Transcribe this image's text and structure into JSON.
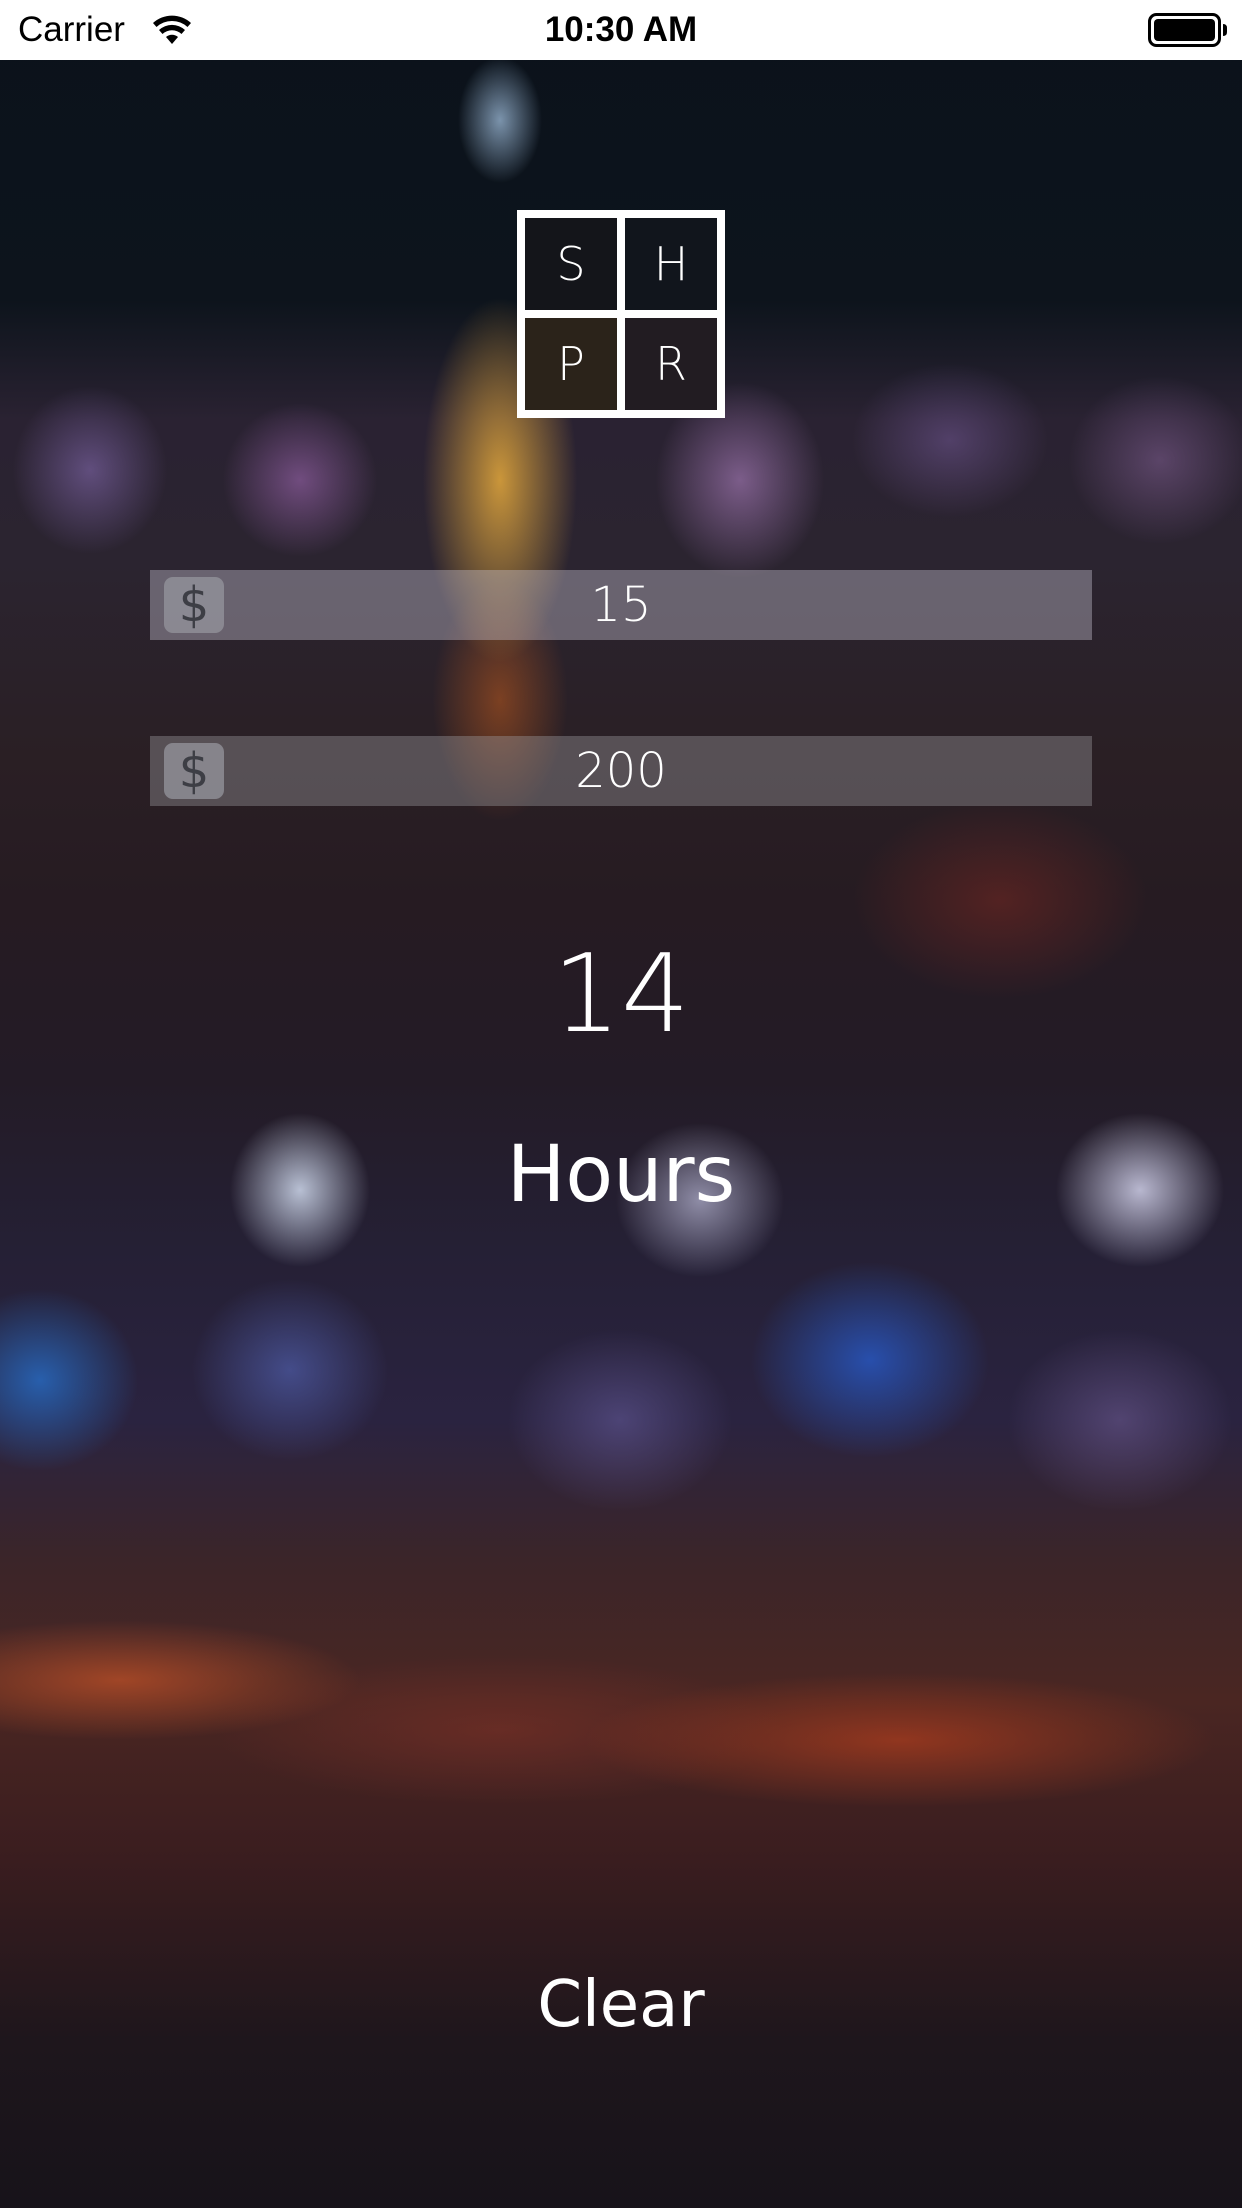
{
  "status_bar": {
    "carrier": "Carrier",
    "time": "10:30 AM",
    "wifi_icon": "wifi-icon",
    "battery_icon": "battery-icon"
  },
  "logo": {
    "letters": [
      "S",
      "H",
      "P",
      "R"
    ]
  },
  "fields": [
    {
      "icon": "dollar-icon",
      "icon_glyph": "$",
      "value": "15"
    },
    {
      "icon": "dollar-icon",
      "icon_glyph": "$",
      "value": "200"
    }
  ],
  "result": {
    "value": "14",
    "unit": "Hours"
  },
  "actions": {
    "clear_label": "Clear"
  },
  "colors": {
    "text": "#ffffff",
    "status_bar_bg": "#ffffff"
  }
}
